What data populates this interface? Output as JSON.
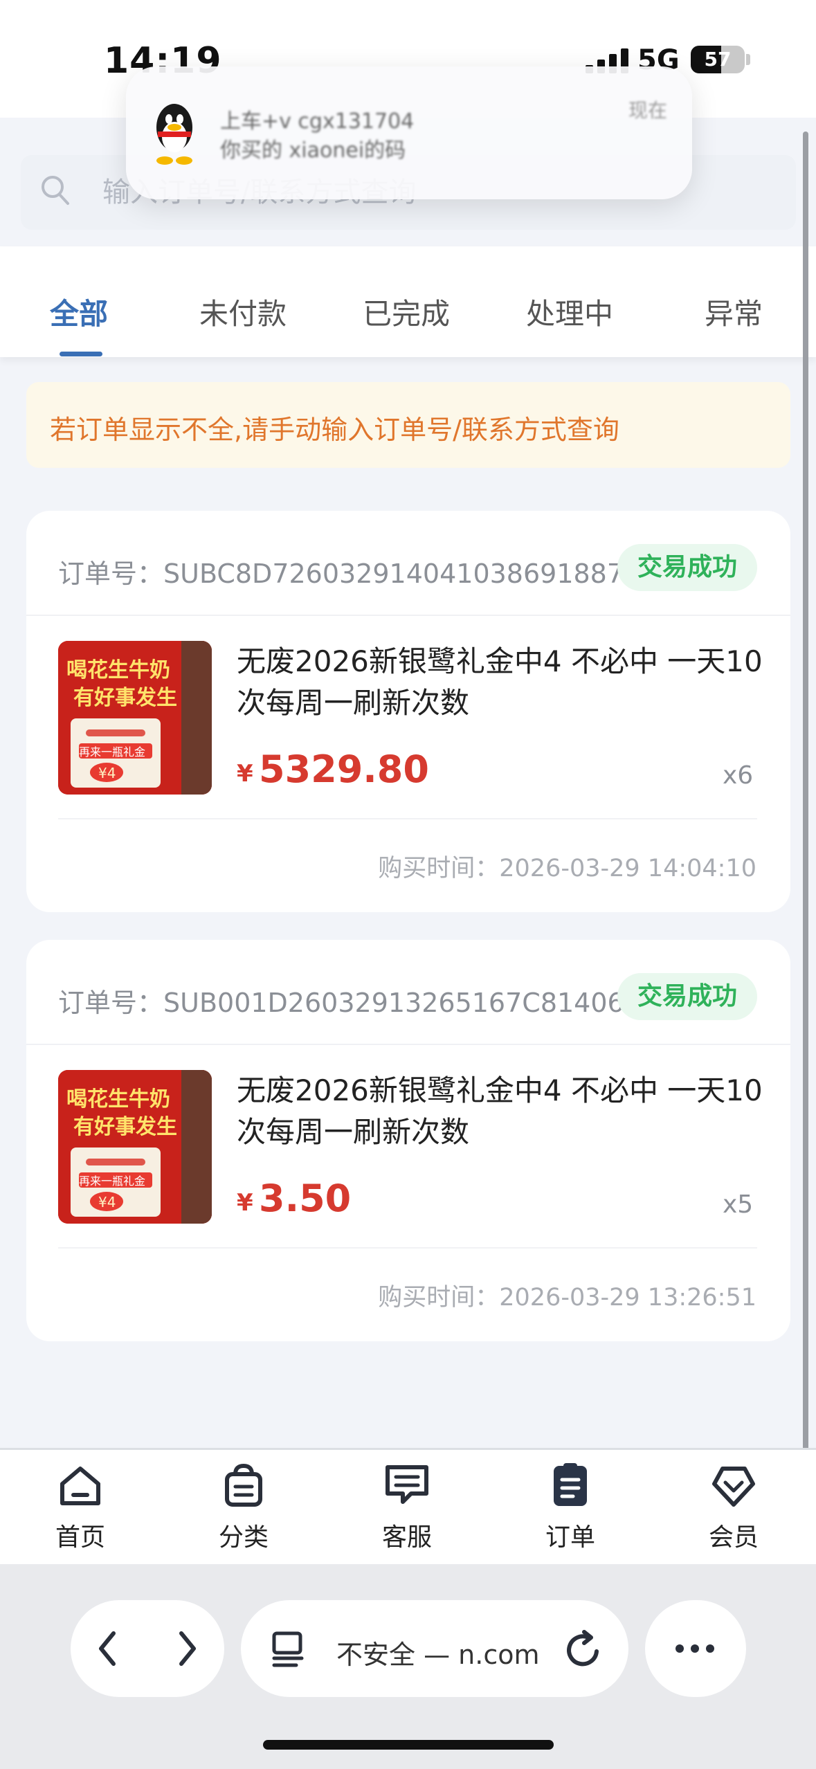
{
  "status_bar": {
    "time": "14:19",
    "network": "5G",
    "battery": "57",
    "battery_level_percent": 57
  },
  "notification": {
    "app_icon": "qq-penguin-icon",
    "title": "上车+v cgx131704",
    "body": "你买的 xiaonei的码",
    "time": "现在"
  },
  "search": {
    "placeholder": "输入订单号/联系方式查询"
  },
  "tabs": [
    {
      "label": "全部",
      "active": true
    },
    {
      "label": "未付款",
      "active": false
    },
    {
      "label": "已完成",
      "active": false
    },
    {
      "label": "处理中",
      "active": false
    },
    {
      "label": "异常",
      "active": false
    }
  ],
  "notice": "若订单显示不全,请手动输入订单号/联系方式查询",
  "orders": [
    {
      "order_label": "订单号：",
      "order_no": "SUBC8D7260329140410386918​87",
      "status": "交易成功",
      "image": {
        "line1": "喝花生牛奶",
        "line2": "有好事发生",
        "coupon_tag": "再来一瓶礼金",
        "coupon_amount": "¥4"
      },
      "title": "无废2026新银鹭礼金中4 不必中 一天10次每周一刷新次数",
      "currency": "¥",
      "price": "5329.80",
      "quantity": "x6",
      "time_label": "购买时间：",
      "time": "2026-03-29 14:04:10"
    },
    {
      "order_label": "订单号：",
      "order_no": "SUB001D26032913265167C81406",
      "status": "交易成功",
      "image": {
        "line1": "喝花生牛奶",
        "line2": "有好事发生",
        "coupon_tag": "再来一瓶礼金",
        "coupon_amount": "¥4"
      },
      "title": "无废2026新银鹭礼金中4 不必中 一天10次每周一刷新次数",
      "currency": "¥",
      "price": "3.50",
      "quantity": "x5",
      "time_label": "购买时间：",
      "time": "2026-03-29 13:26:51"
    }
  ],
  "bottom_nav": [
    {
      "label": "首页",
      "icon": "home-icon"
    },
    {
      "label": "分类",
      "icon": "shopping-bag-icon"
    },
    {
      "label": "客服",
      "icon": "chat-icon"
    },
    {
      "label": "订单",
      "icon": "order-clipboard-icon",
      "active": true
    },
    {
      "label": "会员",
      "icon": "diamond-icon"
    }
  ],
  "browser": {
    "url_text": "不安全 — n.com",
    "back": "back-icon",
    "forward": "forward-icon",
    "tabs": "tab-overview-icon",
    "reload": "reload-icon",
    "more": "more-icon"
  },
  "colors": {
    "accent": "#3a6fb5",
    "price": "#d63a2f",
    "success": "#2fb25a",
    "notice_text": "#e0762c",
    "notice_bg": "#fdf8e9"
  }
}
